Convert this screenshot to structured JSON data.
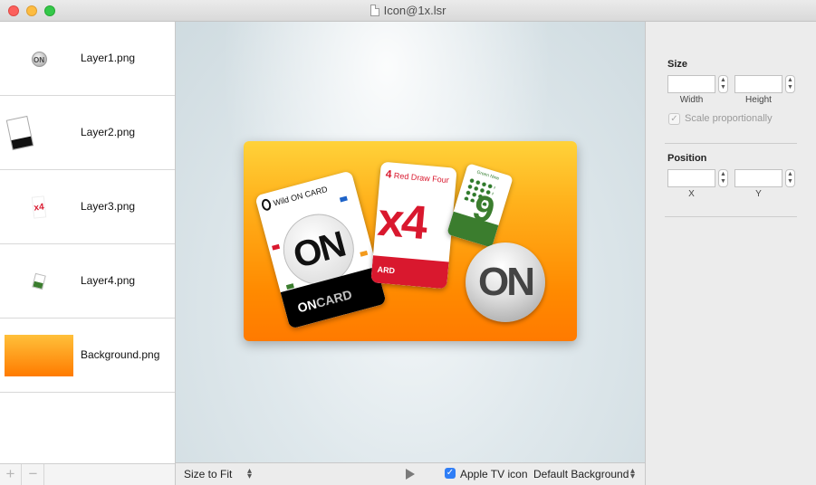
{
  "window": {
    "title": "Icon@1x.lsr"
  },
  "sidebar": {
    "layers": [
      {
        "name": "Layer1.png",
        "thumb": "on-logo-thumbnail"
      },
      {
        "name": "Layer2.png",
        "thumb": "wild-on-card-thumbnail"
      },
      {
        "name": "Layer3.png",
        "thumb": "red-x4-card-thumbnail"
      },
      {
        "name": "Layer4.png",
        "thumb": "green-9-card-thumbnail"
      },
      {
        "name": "Background.png",
        "thumb": "orange-gradient-thumbnail"
      }
    ],
    "add_label": "+",
    "remove_label": "−"
  },
  "preview": {
    "wild_card_title": "Wild ON CARD",
    "wild_card_center": "ON",
    "wild_card_band_on": "ON",
    "wild_card_band_card": "CARD",
    "x4_number": "4",
    "x4_title": "Red Draw Four",
    "x4_big": "x4",
    "x4_band": "ARD",
    "g9_title": "Green Nine",
    "g9_big": "9",
    "on_badge": "ON"
  },
  "bottombar": {
    "zoom_label": "Size to Fit",
    "apple_tv_checked": true,
    "apple_tv_label": "Apple TV icon",
    "background_label": "Default Background"
  },
  "inspector": {
    "size_title": "Size",
    "width_label": "Width",
    "height_label": "Height",
    "width_value": "",
    "height_value": "",
    "scale_label": "Scale proportionally",
    "scale_checked": true,
    "position_title": "Position",
    "x_label": "X",
    "y_label": "Y",
    "x_value": "",
    "y_value": ""
  },
  "colors": {
    "accent": "#2f7ef6",
    "orange_top": "#ffd23a",
    "orange_bottom": "#ff7a00",
    "card_red": "#d9182e",
    "card_green": "#3b7d2e"
  }
}
